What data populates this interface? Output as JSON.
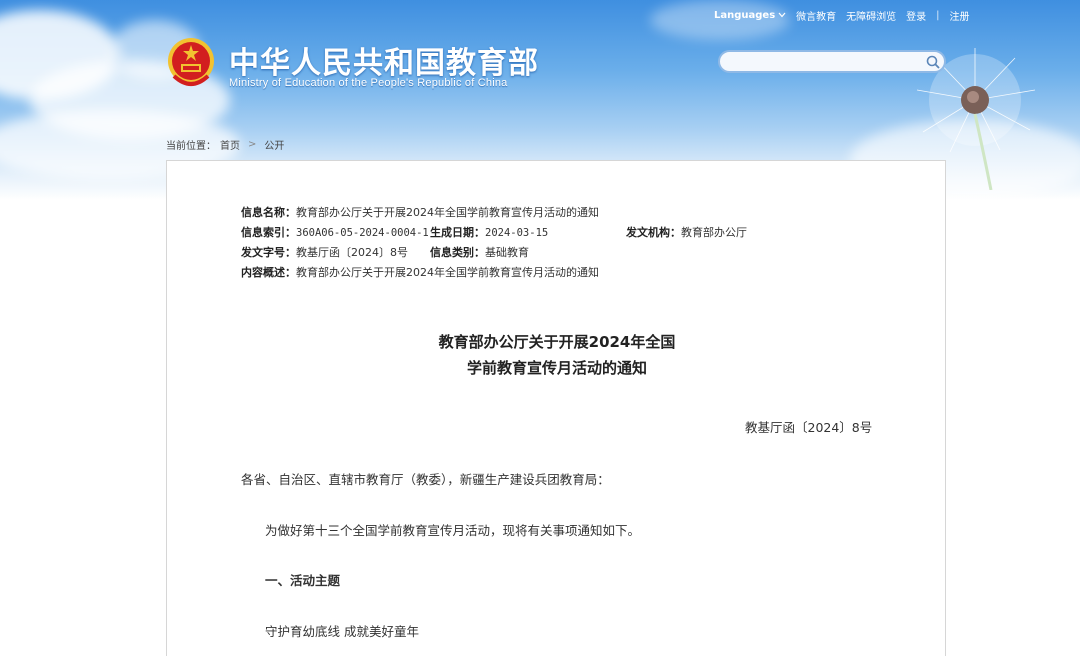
{
  "header": {
    "top_links": {
      "languages": "Languages",
      "wechat_edu": "微言教育",
      "accessibility": "无障碍浏览",
      "login": "登录",
      "divider": "|",
      "register": "注册"
    },
    "site_title": "中华人民共和国教育部",
    "site_subtitle": "Ministry of Education of the People's Republic of China",
    "search": {
      "value": "",
      "placeholder": ""
    }
  },
  "breadcrumb": {
    "prefix": "当前位置：",
    "home": "首页",
    "separator": ">",
    "current": "公开"
  },
  "meta": {
    "info_name_label": "信息名称：",
    "info_name": "教育部办公厅关于开展2024年全国学前教育宣传月活动的通知",
    "index_label": "信息索引：",
    "index": "360A06-05-2024-0004-1",
    "date_label": "生成日期：",
    "date": "2024-03-15",
    "issuer_label": "发文机构：",
    "issuer": "教育部办公厅",
    "doc_no_label": "发文字号：",
    "doc_no": "教基厅函〔2024〕8号",
    "category_label": "信息类别：",
    "category": "基础教育",
    "summary_label": "内容概述：",
    "summary": "教育部办公厅关于开展2024年全国学前教育宣传月活动的通知"
  },
  "document": {
    "title_line1": "教育部办公厅关于开展2024年全国",
    "title_line2": "学前教育宣传月活动的通知",
    "doc_number": "教基厅函〔2024〕8号",
    "addressee": "各省、自治区、直辖市教育厅（教委），新疆生产建设兵团教育局：",
    "intro": "为做好第十三个全国学前教育宣传月活动，现将有关事项通知如下。",
    "section1_heading": "一、活动主题",
    "section1_text": "守护育幼底线 成就美好童年"
  },
  "colors": {
    "sky_top": "#3f8fe0",
    "search_border": "#8fb9e6",
    "emblem_red": "#d21f1f",
    "emblem_gold": "#f2c230"
  }
}
